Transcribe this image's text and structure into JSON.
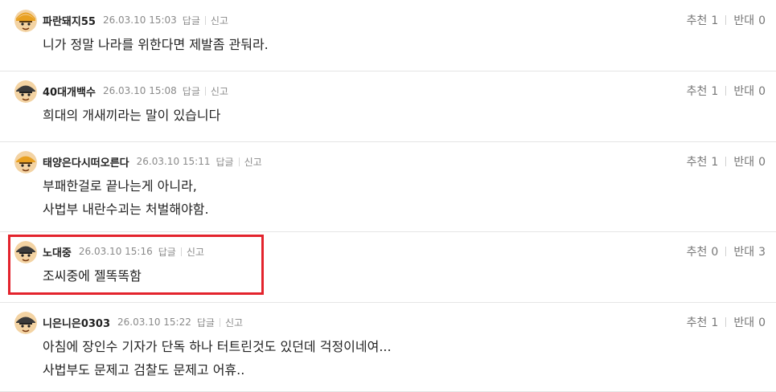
{
  "comments": [
    {
      "nick": "파란돼지55",
      "date": "26.03.10 15:03",
      "reply": "답글",
      "report": "신고",
      "lines": [
        "니가 정말 나라를 위한다면 제발좀 관둬라."
      ],
      "up_label": "추천",
      "up": "1",
      "down_label": "반대",
      "down": "0",
      "helmet": "#e8a020"
    },
    {
      "nick": "40대개백수",
      "date": "26.03.10 15:08",
      "reply": "답글",
      "report": "신고",
      "lines": [
        "희대의 개새끼라는 말이 있습니다"
      ],
      "up_label": "추천",
      "up": "1",
      "down_label": "반대",
      "down": "0",
      "helmet": "#3a3a3a"
    },
    {
      "nick": "태양은다시떠오른다",
      "date": "26.03.10 15:11",
      "reply": "답글",
      "report": "신고",
      "lines": [
        "부패한걸로 끝나는게 아니라,",
        "사법부 내란수괴는 처벌해야함."
      ],
      "up_label": "추천",
      "up": "1",
      "down_label": "반대",
      "down": "0",
      "helmet": "#e8a020"
    },
    {
      "nick": "노대중",
      "date": "26.03.10 15:16",
      "reply": "답글",
      "report": "신고",
      "lines": [
        "조씨중에 젤똑똑함"
      ],
      "up_label": "추천",
      "up": "0",
      "down_label": "반대",
      "down": "3",
      "helmet": "#3a3a3a"
    },
    {
      "nick": "니은니은0303",
      "date": "26.03.10 15:22",
      "reply": "답글",
      "report": "신고",
      "lines": [
        "아침에 장인수 기자가 단독 하나 터트린것도 있던데 걱정이네여...",
        "사법부도 문제고 검찰도 문제고 어휴.."
      ],
      "up_label": "추천",
      "up": "1",
      "down_label": "반대",
      "down": "0",
      "helmet": "#3a3a3a"
    }
  ],
  "colors": {
    "highlight": "#e3232c",
    "divider": "#e5e5e5",
    "meta": "#8a8a8a"
  }
}
